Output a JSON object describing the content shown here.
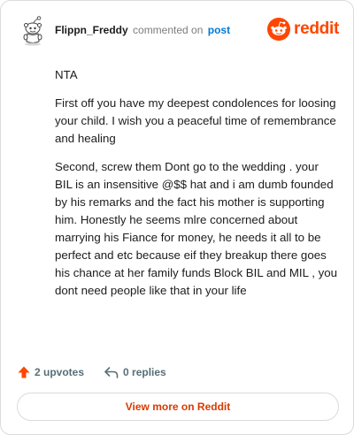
{
  "header": {
    "username": "Flippn_Freddy",
    "action_text": "commented on",
    "post_link": "post",
    "brand_name": "reddit",
    "avatar_icon": "snoo-avatar-icon",
    "brand_icon": "reddit-logo-icon"
  },
  "comment": {
    "paragraphs": [
      "NTA",
      "First off you have my deepest condolences for loosing your child. I wish you a peaceful time of remembrance and healing",
      "Second, screw them Dont go to the wedding . your BIL is an insensitive @$$ hat and i am dumb founded by his remarks and the fact his mother is supporting him. Honestly he seems mlre concerned about marrying his Fiance for money, he needs it all to be perfect and etc because eif they breakup there goes his chance at her family funds Block BIL and MIL , you dont need people like that in your life"
    ]
  },
  "actions": {
    "upvotes_label": "2 upvotes",
    "replies_label": "0 replies",
    "upvote_icon": "upvote-arrow-icon",
    "reply_icon": "reply-arrow-icon"
  },
  "cta": {
    "view_more_label": "View more on Reddit"
  },
  "colors": {
    "brand": "#ff4500",
    "link": "#0079d3",
    "cta_text": "#d93a00",
    "muted": "#7c7c7c",
    "border": "#d9dbdd"
  }
}
